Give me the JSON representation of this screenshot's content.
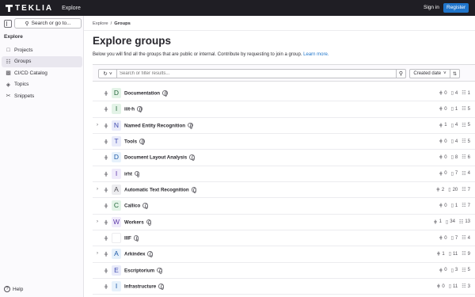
{
  "header": {
    "brand": "TEKLIA",
    "section": "Explore",
    "sign_in": "Sign in",
    "register": "Register",
    "colors": {
      "bar": "#1f1e24",
      "accent": "#1f75cb"
    }
  },
  "sidebar": {
    "search_label": "Search or go to...",
    "title": "Explore",
    "items": [
      {
        "label": "Projects",
        "icon": "project-icon"
      },
      {
        "label": "Groups",
        "icon": "group-icon",
        "active": true
      },
      {
        "label": "CI/CD Catalog",
        "icon": "catalog-icon"
      },
      {
        "label": "Topics",
        "icon": "label-icon"
      },
      {
        "label": "Snippets",
        "icon": "snippet-icon"
      }
    ],
    "help": "Help"
  },
  "breadcrumb": {
    "root": "Explore",
    "separator": "/",
    "current": "Groups"
  },
  "page": {
    "title": "Explore groups",
    "description": "Below you will find all the groups that are public or internal. Contribute by requesting to join a group.",
    "learn_more": "Learn more."
  },
  "filter": {
    "placeholder": "Search or filter results...",
    "sort_label": "Created date"
  },
  "groups": [
    {
      "letter": "D",
      "name": "Documentation",
      "expandable": false,
      "subgroups": "0",
      "projects": "4",
      "members": "1",
      "avatar_bg": "#e3f3e7",
      "avatar_fg": "#24663b"
    },
    {
      "letter": "I",
      "name": "iiit-h",
      "expandable": false,
      "subgroups": "0",
      "projects": "1",
      "members": "5",
      "avatar_bg": "#e3f3e7",
      "avatar_fg": "#24663b"
    },
    {
      "letter": "N",
      "name": "Named Entity Recognition",
      "expandable": true,
      "subgroups": "1",
      "projects": "4",
      "members": "5",
      "avatar_bg": "#e9ebfa",
      "avatar_fg": "#3f4bb0"
    },
    {
      "letter": "T",
      "name": "Tools",
      "expandable": false,
      "subgroups": "0",
      "projects": "4",
      "members": "5",
      "avatar_bg": "#e9ebfa",
      "avatar_fg": "#3f4bb0"
    },
    {
      "letter": "D",
      "name": "Document Layout Analysis",
      "expandable": false,
      "subgroups": "0",
      "projects": "8",
      "members": "6",
      "avatar_bg": "#e6f1fb",
      "avatar_fg": "#1e5aa8"
    },
    {
      "letter": "I",
      "name": "irht",
      "expandable": false,
      "subgroups": "0",
      "projects": "7",
      "members": "4",
      "avatar_bg": "#f0ebfb",
      "avatar_fg": "#5f3aa8"
    },
    {
      "letter": "A",
      "name": "Automatic Text Recognition",
      "expandable": true,
      "subgroups": "2",
      "projects": "20",
      "members": "7",
      "avatar_bg": "#ececef",
      "avatar_fg": "#535158"
    },
    {
      "letter": "C",
      "name": "Callico",
      "expandable": false,
      "subgroups": "0",
      "projects": "1",
      "members": "7",
      "avatar_bg": "#e3f3e7",
      "avatar_fg": "#24663b"
    },
    {
      "letter": "W",
      "name": "Workers",
      "expandable": true,
      "subgroups": "1",
      "projects": "34",
      "members": "13",
      "avatar_bg": "#f0ebfb",
      "avatar_fg": "#5f3aa8"
    },
    {
      "letter": "",
      "name": "IIIF",
      "expandable": false,
      "subgroups": "0",
      "projects": "7",
      "members": "4",
      "avatar_bg": "#ffffff",
      "avatar_fg": "#535158"
    },
    {
      "letter": "A",
      "name": "Arkindex",
      "expandable": true,
      "subgroups": "1",
      "projects": "11",
      "members": "9",
      "avatar_bg": "#e6f1fb",
      "avatar_fg": "#1e5aa8"
    },
    {
      "letter": "E",
      "name": "Escriptorium",
      "expandable": false,
      "subgroups": "0",
      "projects": "3",
      "members": "5",
      "avatar_bg": "#e9ebfa",
      "avatar_fg": "#3f4bb0"
    },
    {
      "letter": "I",
      "name": "Infrastructure",
      "expandable": false,
      "subgroups": "0",
      "projects": "11",
      "members": "3",
      "avatar_bg": "#e6f1fb",
      "avatar_fg": "#1e5aa8"
    }
  ]
}
